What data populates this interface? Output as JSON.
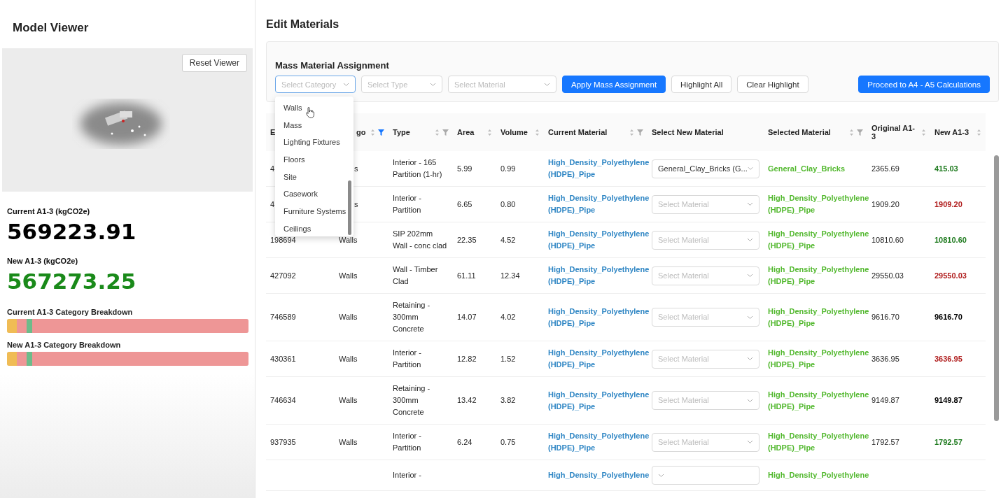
{
  "left_panel": {
    "title": "Model Viewer",
    "reset_button": "Reset Viewer",
    "metrics": [
      {
        "label": "Current A1-3 (kgCO2e)",
        "value": "569223.91",
        "color": "#000000"
      },
      {
        "label": "New A1-3 (kgCO2e)",
        "value": "567273.25",
        "color": "#1a8a1a"
      }
    ],
    "breakdowns": [
      {
        "label": "Current A1-3 Category Breakdown",
        "segments": [
          {
            "color": "#f0bc55",
            "level": 0.04
          },
          {
            "color": "#ee9696",
            "level": 0.04
          },
          {
            "color": "#6dbb8a",
            "level": 0.025
          },
          {
            "color": "#ee9696",
            "level": 0.895
          }
        ]
      },
      {
        "label": "New A1-3 Category Breakdown",
        "segments": [
          {
            "color": "#f0bc55",
            "level": 0.04
          },
          {
            "color": "#ee9696",
            "level": 0.04
          },
          {
            "color": "#6dbb8a",
            "level": 0.025
          },
          {
            "color": "#ee9696",
            "level": 0.895
          }
        ]
      }
    ]
  },
  "main": {
    "title": "Edit Materials",
    "mass": {
      "title": "Mass Material Assignment",
      "selects": [
        {
          "placeholder": "Select Category",
          "focused": true
        },
        {
          "placeholder": "Select Type",
          "focused": false
        },
        {
          "placeholder": "Select Material",
          "focused": false
        }
      ],
      "buttons": [
        {
          "label": "Apply Mass Assignment",
          "primary": true
        },
        {
          "label": "Highlight All",
          "primary": false
        },
        {
          "label": "Clear Highlight",
          "primary": false
        }
      ],
      "proceed_button": "Proceed to A4 - A5 Calculations",
      "dropdown": {
        "open": true,
        "options": [
          "Walls",
          "Mass",
          "Lighting Fixtures",
          "Floors",
          "Site",
          "Casework",
          "Furniture Systems",
          "Ceilings"
        ]
      }
    },
    "table": {
      "columns": [
        {
          "label": "E",
          "sortable": false
        },
        {
          "label": "go",
          "sortable": true,
          "filter_active": true
        },
        {
          "label": "Type",
          "sortable": true,
          "filter_active": false
        },
        {
          "label": "Area",
          "sortable": true
        },
        {
          "label": "Volume",
          "sortable": true
        },
        {
          "label": "Current Material",
          "sortable": true,
          "filter_active": false
        },
        {
          "label": "Select New Material",
          "sortable": false
        },
        {
          "label": "Selected Material",
          "sortable": true,
          "filter_active": false
        },
        {
          "label": "Original A1-3",
          "sortable": true
        },
        {
          "label": "New A1-3",
          "sortable": true
        }
      ],
      "rows": [
        {
          "id": "4",
          "category": "s",
          "type": "Interior - 165 Partition (1-hr)",
          "area": "5.99",
          "volume": "0.99",
          "current": "High_Density_Polyethylene (HDPE)_Pipe",
          "new_material": {
            "value": "General_Clay_Bricks (G..."
          },
          "selected": "General_Clay_Bricks",
          "original": "2365.69",
          "new": "415.03",
          "color": "#1e7a1e"
        },
        {
          "id": "4",
          "category": "s",
          "type": "Interior - Partition",
          "area": "6.65",
          "volume": "0.80",
          "current": "High_Density_Polyethylene (HDPE)_Pipe",
          "new_material": {
            "placeholder": "Select Material"
          },
          "selected": "High_Density_Polyethylene (HDPE)_Pipe",
          "original": "1909.20",
          "new": "1909.20",
          "color": "#b01c1c"
        },
        {
          "id": "198694",
          "category": "Walls",
          "type": "SIP 202mm Wall - conc clad",
          "area": "22.35",
          "volume": "4.52",
          "current": "High_Density_Polyethylene (HDPE)_Pipe",
          "new_material": {
            "placeholder": "Select Material"
          },
          "selected": "High_Density_Polyethylene (HDPE)_Pipe",
          "original": "10810.60",
          "new": "10810.60",
          "color": "#1e7a1e"
        },
        {
          "id": "427092",
          "category": "Walls",
          "type": "Wall - Timber Clad",
          "area": "61.11",
          "volume": "12.34",
          "current": "High_Density_Polyethylene (HDPE)_Pipe",
          "new_material": {
            "placeholder": "Select Material"
          },
          "selected": "High_Density_Polyethylene (HDPE)_Pipe",
          "original": "29550.03",
          "new": "29550.03",
          "color": "#b01c1c"
        },
        {
          "id": "746589",
          "category": "Walls",
          "type": "Retaining - 300mm Concrete",
          "area": "14.07",
          "volume": "4.02",
          "current": "High_Density_Polyethylene (HDPE)_Pipe",
          "new_material": {
            "placeholder": "Select Material"
          },
          "selected": "High_Density_Polyethylene (HDPE)_Pipe",
          "original": "9616.70",
          "new": "9616.70",
          "color": "#000000"
        },
        {
          "id": "430361",
          "category": "Walls",
          "type": "Interior - Partition",
          "area": "12.82",
          "volume": "1.52",
          "current": "High_Density_Polyethylene (HDPE)_Pipe",
          "new_material": {
            "placeholder": "Select Material"
          },
          "selected": "High_Density_Polyethylene (HDPE)_Pipe",
          "original": "3636.95",
          "new": "3636.95",
          "color": "#b01c1c"
        },
        {
          "id": "746634",
          "category": "Walls",
          "type": "Retaining - 300mm Concrete",
          "area": "13.42",
          "volume": "3.82",
          "current": "High_Density_Polyethylene (HDPE)_Pipe",
          "new_material": {
            "placeholder": "Select Material"
          },
          "selected": "High_Density_Polyethylene (HDPE)_Pipe",
          "original": "9149.87",
          "new": "9149.87",
          "color": "#000000"
        },
        {
          "id": "937935",
          "category": "Walls",
          "type": "Interior - Partition",
          "area": "6.24",
          "volume": "0.75",
          "current": "High_Density_Polyethylene (HDPE)_Pipe",
          "new_material": {
            "placeholder": "Select Material"
          },
          "selected": "High_Density_Polyethylene (HDPE)_Pipe",
          "original": "1792.57",
          "new": "1792.57",
          "color": "#1e7a1e"
        },
        {
          "type": "Interior -",
          "current": "High_Density_Polyethylene",
          "new_material": {},
          "selected": "High_Density_Polyethylene"
        }
      ]
    }
  }
}
